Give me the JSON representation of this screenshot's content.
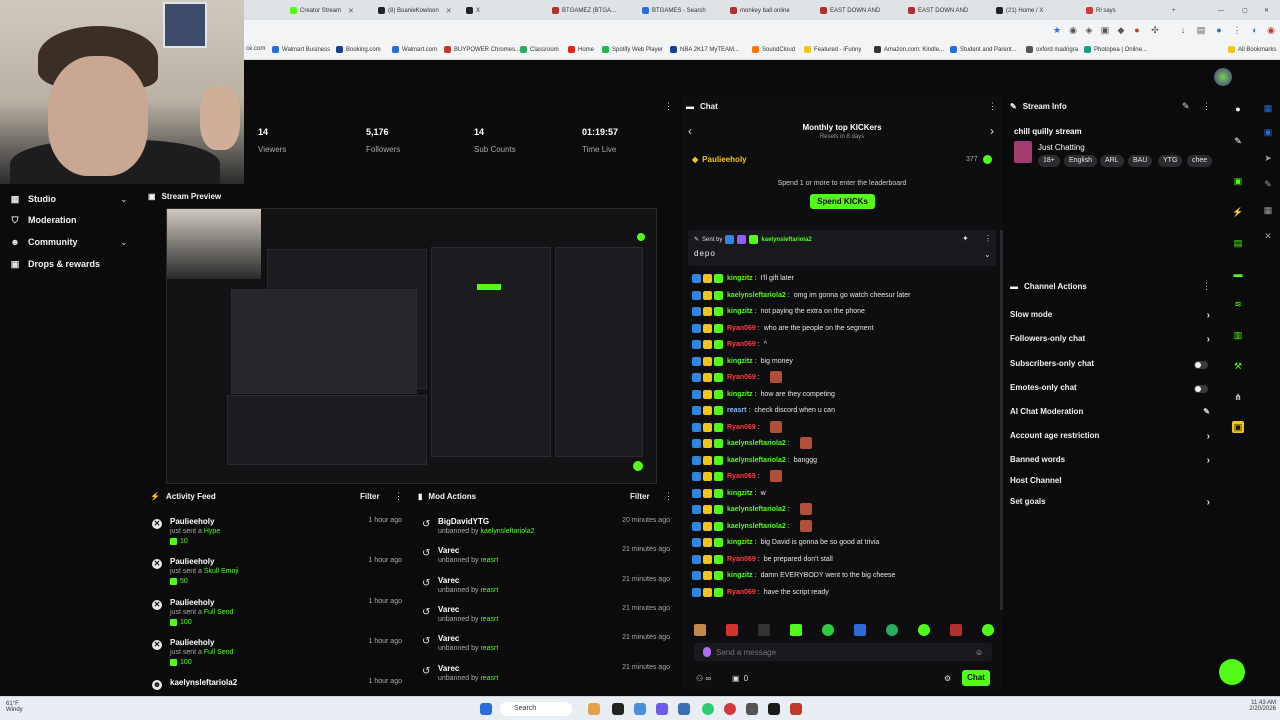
{
  "browser": {
    "tabs": [
      {
        "label": "Creator Stream"
      },
      {
        "label": "(8) BoanieKowloon"
      },
      {
        "label": "X"
      },
      {
        "label": "BTGAMEZ (BTGA..."
      },
      {
        "label": "BTGAMES - Search"
      },
      {
        "label": "monkey ball online"
      },
      {
        "label": "EAST DOWN AND"
      },
      {
        "label": "EAST DOWN AND"
      },
      {
        "label": "(21) Home / X"
      },
      {
        "label": "Ri says"
      }
    ],
    "bookmarks": [
      {
        "label": "Walmart Business"
      },
      {
        "label": "Booking.com"
      },
      {
        "label": "Walmart.com"
      },
      {
        "label": "BUYPOWER Chromes..."
      },
      {
        "label": "Classroom"
      },
      {
        "label": "Home"
      },
      {
        "label": "Spotify Web Player"
      },
      {
        "label": "NBA 2K17 MyTEAM..."
      },
      {
        "label": "SoundCloud"
      },
      {
        "label": "Featured - iFunny"
      },
      {
        "label": "Amazon.com: Kindle..."
      },
      {
        "label": "Student and Parent..."
      },
      {
        "label": "oxford madrigra"
      },
      {
        "label": "Photopea | Online..."
      },
      {
        "label": "All Bookmarks"
      }
    ]
  },
  "nav": {
    "items": [
      {
        "label": "Studio",
        "icon": "grid-icon",
        "expandable": true
      },
      {
        "label": "Moderation",
        "icon": "shield-icon",
        "expandable": false
      },
      {
        "label": "Community",
        "icon": "people-icon",
        "expandable": true
      },
      {
        "label": "Drops & rewards",
        "icon": "gift-icon",
        "expandable": false
      }
    ]
  },
  "stats": [
    {
      "value": "14",
      "label": "Viewers"
    },
    {
      "value": "5,176",
      "label": "Followers"
    },
    {
      "value": "14",
      "label": "Sub Counts"
    },
    {
      "value": "01:19:57",
      "label": "Time Live"
    }
  ],
  "preview": {
    "title": "Stream Preview"
  },
  "activity_feed": {
    "title": "Activity Feed",
    "filter_label": "Filter",
    "items": [
      {
        "name": "Paulieeholy",
        "prefix": "just sent a",
        "item": "Hype",
        "amount": "10",
        "time": "1 hour ago"
      },
      {
        "name": "Paulieeholy",
        "prefix": "just sent a",
        "item": "Skull Emoji",
        "amount": "50",
        "time": "1 hour ago"
      },
      {
        "name": "Paulieeholy",
        "prefix": "just sent a",
        "item": "Full Send",
        "amount": "100",
        "time": "1 hour ago"
      },
      {
        "name": "Paulieeholy",
        "prefix": "just sent a",
        "item": "Full Send",
        "amount": "100",
        "time": "1 hour ago"
      },
      {
        "name": "kaelynsleftariola2",
        "prefix": "",
        "item": "",
        "amount": "",
        "time": "1 hour ago"
      }
    ]
  },
  "mod_actions": {
    "title": "Mod Actions",
    "filter_label": "Filter",
    "items": [
      {
        "name": "BigDavidYTG",
        "action": "unbanned by",
        "target": "kaelynsleftariola2",
        "time": "20 minutes ago"
      },
      {
        "name": "Varec",
        "action": "unbanned by",
        "target": "reasrt",
        "time": "21 minutes ago"
      },
      {
        "name": "Varec",
        "action": "unbanned by",
        "target": "reasrt",
        "time": "21 minutes ago"
      },
      {
        "name": "Varec",
        "action": "unbanned by",
        "target": "reasrt",
        "time": "21 minutes ago"
      },
      {
        "name": "Varec",
        "action": "unbanned by",
        "target": "reasrt",
        "time": "21 minutes ago"
      },
      {
        "name": "Varec",
        "action": "unbanned by",
        "target": "reasrt",
        "time": "21 minutes ago"
      }
    ]
  },
  "chat": {
    "title": "Chat",
    "leaderboard_title": "Monthly top KICKers",
    "leaderboard_sub": "Resets in 8 days",
    "top_user": "Paulieeholy",
    "top_amount": "377",
    "spend_text": "Spend 1 or more to enter the leaderboard",
    "spend_button": "Spend KICKs",
    "pinned_sent_by": "Sent by",
    "pinned_user": "kaelynsleftariola2",
    "pinned_text": "depo",
    "messages": [
      {
        "user": "kingzitz",
        "color": "#53fc18",
        "text": "I'll gift later",
        "emote": false
      },
      {
        "user": "kaelynsleftariola2",
        "color": "#53fc18",
        "text": "omg im gonna go watch cheesur later",
        "emote": false
      },
      {
        "user": "kingzitz",
        "color": "#53fc18",
        "text": "not paying the extra on the phone",
        "emote": false
      },
      {
        "user": "Ryan069",
        "color": "#ff3b3b",
        "text": "who are the people on the segment",
        "emote": false
      },
      {
        "user": "Ryan069",
        "color": "#ff3b3b",
        "text": "^",
        "emote": false
      },
      {
        "user": "kingzitz",
        "color": "#53fc18",
        "text": "big money",
        "emote": false
      },
      {
        "user": "Ryan069",
        "color": "#ff3b3b",
        "text": "",
        "emote": true
      },
      {
        "user": "kingzitz",
        "color": "#53fc18",
        "text": "how are they competing",
        "emote": false
      },
      {
        "user": "reasrt",
        "color": "#8fb8ff",
        "text": "check discord when u can",
        "emote": false
      },
      {
        "user": "Ryan069",
        "color": "#ff3b3b",
        "text": "",
        "emote": true
      },
      {
        "user": "kaelynsleftariola2",
        "color": "#53fc18",
        "text": "",
        "emote": true
      },
      {
        "user": "kaelynsleftariola2",
        "color": "#53fc18",
        "text": "banggg",
        "emote": false
      },
      {
        "user": "Ryan069",
        "color": "#ff3b3b",
        "text": "",
        "emote": true
      },
      {
        "user": "kingzitz",
        "color": "#53fc18",
        "text": "w",
        "emote": false
      },
      {
        "user": "kaelynsleftariola2",
        "color": "#53fc18",
        "text": "",
        "emote": true
      },
      {
        "user": "kaelynsleftariola2",
        "color": "#53fc18",
        "text": "",
        "emote": true
      },
      {
        "user": "kingzitz",
        "color": "#53fc18",
        "text": "big David is gonna be so good at trivia",
        "emote": false
      },
      {
        "user": "Ryan069",
        "color": "#ff3b3b",
        "text": "be prepared don't stall",
        "emote": false
      },
      {
        "user": "kingzitz",
        "color": "#53fc18",
        "text": "damn EVERYBODY went to the big cheese",
        "emote": false
      },
      {
        "user": "Ryan069",
        "color": "#ff3b3b",
        "text": "have the script ready",
        "emote": false
      }
    ],
    "input_placeholder": "Send a message",
    "count": "0",
    "send_button": "Chat"
  },
  "stream_info": {
    "title": "Stream Info",
    "stream_title": "chill quilly stream",
    "category": "Just Chatting",
    "tags": [
      "18+",
      "English",
      "ARL",
      "BAU",
      "YTG",
      "chee"
    ]
  },
  "channel_actions": {
    "title": "Channel Actions",
    "items": [
      {
        "label": "Slow mode",
        "control": "chevron"
      },
      {
        "label": "Followers-only chat",
        "control": "chevron"
      },
      {
        "label": "Subscribers-only chat",
        "control": "toggle"
      },
      {
        "label": "Emotes-only chat",
        "control": "toggle"
      },
      {
        "label": "AI Chat Moderation",
        "control": "edit"
      },
      {
        "label": "Account age restriction",
        "control": "chevron"
      },
      {
        "label": "Banned words",
        "control": "chevron"
      },
      {
        "label": "Host Channel",
        "control": "none"
      },
      {
        "label": "Set goals",
        "control": "chevron"
      }
    ]
  },
  "taskbar": {
    "search_label": "Search",
    "weather": "61°F",
    "weather_sub": "Windy",
    "time": "11:43 AM",
    "date": "2/20/2026"
  },
  "colors": {
    "accent": "#53fc18",
    "background": "#0b0b0c",
    "panel": "#0e0e10"
  }
}
